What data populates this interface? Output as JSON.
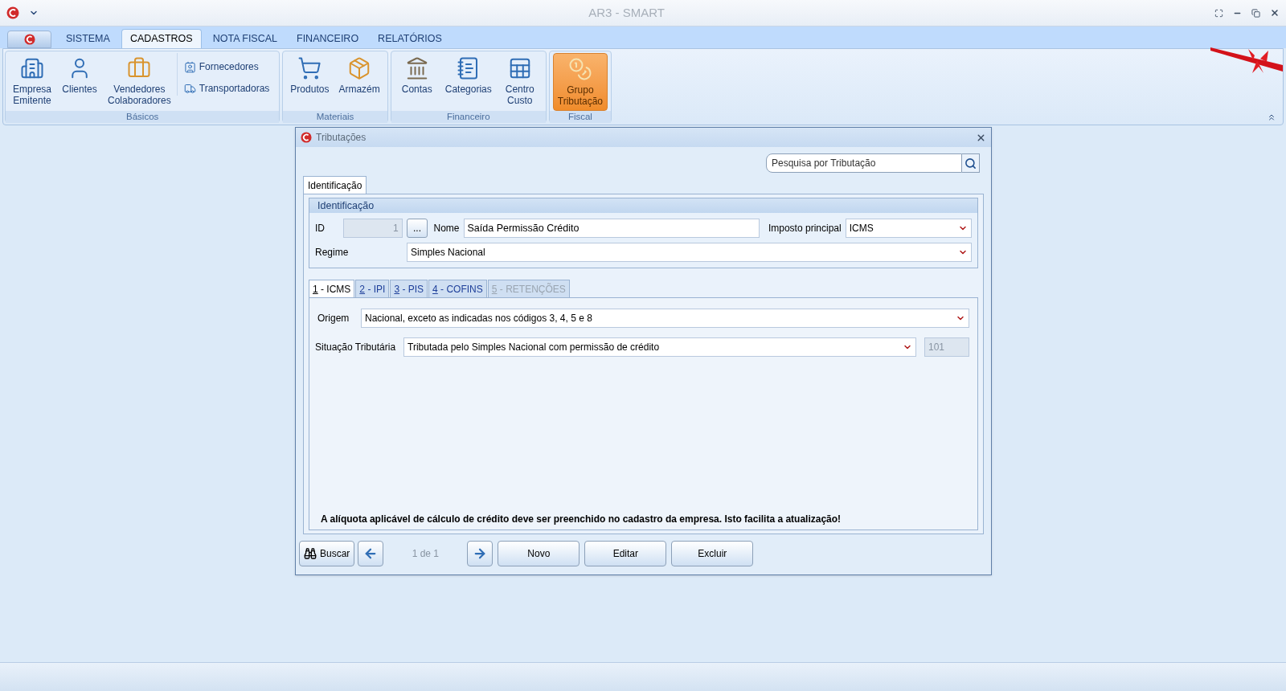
{
  "window": {
    "title": "AR3 - SMART"
  },
  "ribbon_tabs": [
    {
      "label": "SISTEMA",
      "selected": false
    },
    {
      "label": "CADASTROS",
      "selected": true
    },
    {
      "label": "NOTA FISCAL",
      "selected": false
    },
    {
      "label": "FINANCEIRO",
      "selected": false
    },
    {
      "label": "RELATÓRIOS",
      "selected": false
    }
  ],
  "ribbon_groups": [
    {
      "label": "Básicos",
      "items": [
        {
          "kind": "large",
          "label": "Empresa Emitente",
          "selected": false
        },
        {
          "kind": "large",
          "label": "Clientes",
          "selected": false
        },
        {
          "kind": "large",
          "label": "Vendedores Colaboradores",
          "selected": false
        },
        {
          "kind": "small",
          "label": "Fornecedores",
          "selected": false
        },
        {
          "kind": "small",
          "label": "Transportadoras",
          "selected": false
        }
      ]
    },
    {
      "label": "Materiais",
      "items": [
        {
          "kind": "large",
          "label": "Produtos",
          "selected": false
        },
        {
          "kind": "large",
          "label": "Armazém",
          "selected": false
        }
      ]
    },
    {
      "label": "Financeiro",
      "items": [
        {
          "kind": "large",
          "label": "Contas",
          "selected": false
        },
        {
          "kind": "large",
          "label": "Categorias",
          "selected": false
        },
        {
          "kind": "large",
          "label": "Centro Custo",
          "selected": false
        }
      ]
    },
    {
      "label": "Fiscal",
      "items": [
        {
          "kind": "large",
          "label": "Grupo Tributação",
          "selected": true
        }
      ]
    }
  ],
  "dialog": {
    "title": "Tributações",
    "search": {
      "placeholder": "Pesquisa por Tributação"
    },
    "tabs": [
      {
        "label": "Identificação",
        "selected": true
      }
    ],
    "group": {
      "title": "Identificação",
      "id": {
        "label": "ID",
        "value": "1",
        "disabled": true,
        "button": "..."
      },
      "name": {
        "label": "Nome",
        "value": "Saída Permissão Crédito"
      },
      "tax": {
        "label": "Imposto principal",
        "value": "ICMS"
      },
      "regime": {
        "label": "Regime",
        "value": "Simples Nacional"
      }
    },
    "subtabs": [
      {
        "label": "1 - ICMS",
        "selected": true,
        "disabled": false
      },
      {
        "label": "2 - IPI",
        "selected": false,
        "disabled": false
      },
      {
        "label": "3 - PIS",
        "selected": false,
        "disabled": false
      },
      {
        "label": "4 - COFINS",
        "selected": false,
        "disabled": false
      },
      {
        "label": "5 - RETENÇÕES",
        "selected": false,
        "disabled": true
      }
    ],
    "origin": {
      "label": "Origem",
      "value": "Nacional, exceto as indicadas nos códigos 3, 4, 5 e 8"
    },
    "situation": {
      "label": "Situação Tributária",
      "value": "Tributada pelo Simples Nacional com permissão de crédito",
      "code": "101",
      "code_disabled": true
    },
    "note": "A alíquota aplicável de cálculo de crédito deve ser preenchido no cadastro da empresa. Isto facilita a atualização!",
    "nav": {
      "search_button": "Buscar",
      "page": "1 de 1"
    },
    "buttons": [
      "Novo",
      "Editar",
      "Excluir"
    ]
  }
}
